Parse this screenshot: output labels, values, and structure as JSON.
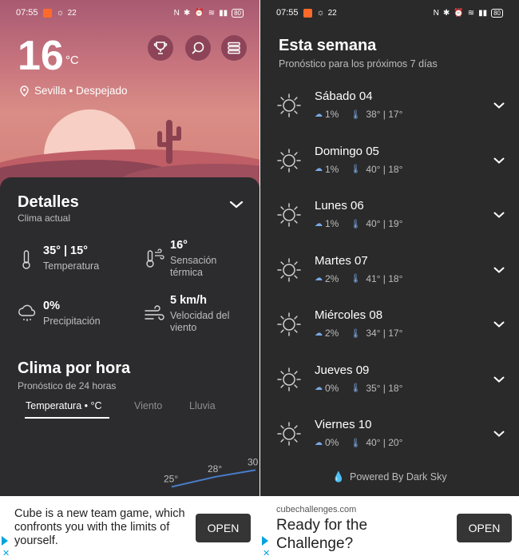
{
  "left": {
    "status": {
      "time": "07:55",
      "temp": "22",
      "battery": "80"
    },
    "current_temp": "16",
    "temp_unit": "°C",
    "location": "Sevilla • Despejado",
    "details": {
      "title": "Detalles",
      "subtitle": "Clima actual",
      "items": [
        {
          "value": "35° | 15°",
          "label": "Temperatura",
          "icon": "thermometer-icon"
        },
        {
          "value": "16°",
          "label": "Sensación térmica",
          "icon": "thermometer-wind-icon"
        },
        {
          "value": "0%",
          "label": "Precipitación",
          "icon": "rain-cloud-icon"
        },
        {
          "value": "5 km/h",
          "label": "Velocidad del viento",
          "icon": "wind-icon"
        }
      ]
    },
    "hourly": {
      "title": "Clima por hora",
      "subtitle": "Pronóstico de 24 horas",
      "tabs": [
        "Temperatura • °C",
        "Viento",
        "Lluvia"
      ],
      "active_tab": 0
    },
    "chart_data": {
      "type": "line",
      "values": [
        25,
        28,
        30
      ],
      "point_labels": [
        "25°",
        "28°",
        "30"
      ]
    },
    "ad": {
      "text": "Cube is a new team game, which confronts you with the limits of yourself.",
      "button": "OPEN"
    }
  },
  "right": {
    "status": {
      "time": "07:55",
      "temp": "22",
      "battery": "80"
    },
    "title": "Esta semana",
    "subtitle": "Pronóstico para los próximos 7 días",
    "days": [
      {
        "name": "Sábado 04",
        "rain": "1%",
        "temps": "38° | 17°"
      },
      {
        "name": "Domingo 05",
        "rain": "1%",
        "temps": "40° | 18°"
      },
      {
        "name": "Lunes 06",
        "rain": "1%",
        "temps": "40° | 19°"
      },
      {
        "name": "Martes 07",
        "rain": "2%",
        "temps": "41° | 18°"
      },
      {
        "name": "Miércoles 08",
        "rain": "2%",
        "temps": "34° | 17°"
      },
      {
        "name": "Jueves 09",
        "rain": "0%",
        "temps": "35° | 18°"
      },
      {
        "name": "Viernes 10",
        "rain": "0%",
        "temps": "40° | 20°"
      }
    ],
    "powered_by": "Powered By Dark Sky",
    "ad": {
      "domain": "cubechallenges.com",
      "headline": "Ready for the Challenge?",
      "button": "OPEN"
    }
  },
  "colors": {
    "hero_top": "#a85a72",
    "hero_bottom": "#d4807a",
    "card_bg": "#2c2c2e",
    "accent_blue": "#7aa9e6",
    "chart_line": "#4a7cc9"
  }
}
